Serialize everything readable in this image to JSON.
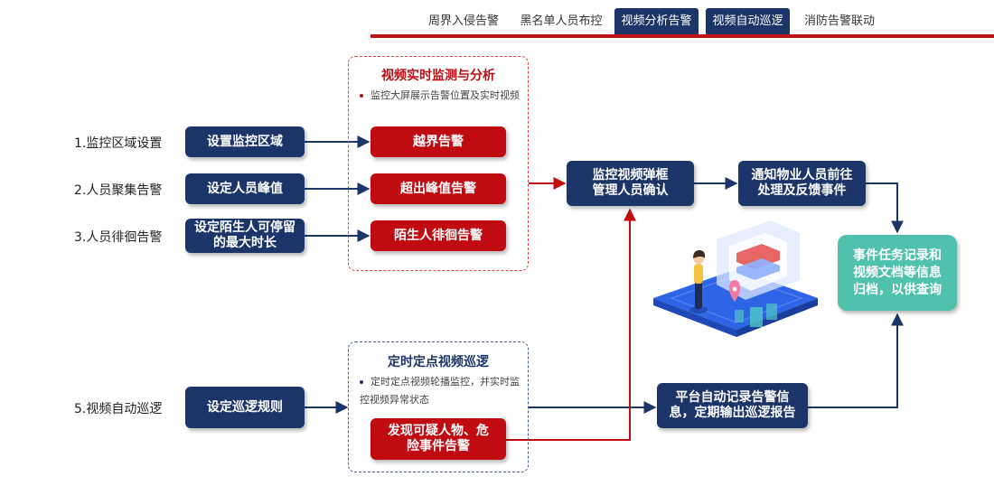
{
  "tabs": [
    {
      "label": "周界入侵告警",
      "active": false
    },
    {
      "label": "黑名单人员布控",
      "active": false
    },
    {
      "label": "视频分析告警",
      "active": true
    },
    {
      "label": "视频自动巡逻",
      "active": true
    },
    {
      "label": "消防告警联动",
      "active": false
    }
  ],
  "rows": [
    {
      "label": "1.监控区域设置",
      "setting": "设置监控区域",
      "alert": "越界告警"
    },
    {
      "label": "2.人员聚集告警",
      "setting": "设定人员峰值",
      "alert": "超出峰值告警"
    },
    {
      "label": "3.人员徘徊告警",
      "setting": "设定陌生人可停留的最大时长",
      "alert": "陌生人徘徊告警"
    }
  ],
  "monitor_group": {
    "title": "视频实时监测与分析",
    "note": "监控大屏展示告警位置及实时视频"
  },
  "patrol": {
    "label": "5.视频自动巡逻",
    "setting": "设定巡逻规则",
    "group_title": "定时定点视频巡逻",
    "note": "定时定点视频轮播监控，并实时监控视频异常状态",
    "alert": "发现可疑人物、危险事件告警"
  },
  "process": {
    "confirm": "监控视频弹框管理人员确认",
    "notify": "通知物业人员前往处理及反馈事件",
    "record": "平台自动记录告警信息，定期输出巡逻报告",
    "archive": "事件任务记录和视频文档等信息归档，以供查询"
  },
  "colors": {
    "navy": "#1b3568",
    "red": "#c00b12",
    "teal": "#4fc1ad",
    "tab_line": "#c0141b"
  }
}
